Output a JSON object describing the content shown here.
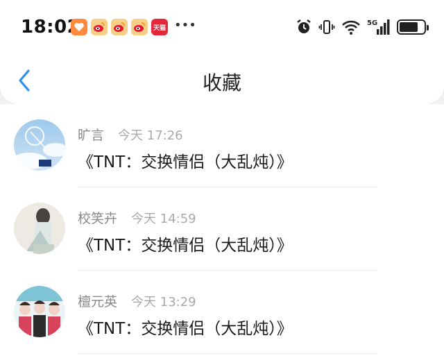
{
  "status_bar": {
    "time": "18:02",
    "app_icons": [
      {
        "name": "orange-app-icon",
        "glyph": "♡",
        "color": "#ff8a3d"
      },
      {
        "name": "weibo-icon",
        "glyph": "◉",
        "color": "#f6d089"
      },
      {
        "name": "weibo-icon",
        "glyph": "◉",
        "color": "#f6d089"
      },
      {
        "name": "weibo-icon",
        "glyph": "◉",
        "color": "#f6d089"
      },
      {
        "name": "tmall-icon",
        "glyph": "天猫",
        "color": "#e4283a"
      }
    ],
    "more": "•••",
    "network_label": "5G",
    "battery_level": 0.75
  },
  "navbar": {
    "back_icon": "chevron-left-icon",
    "title": "收藏",
    "accent": "#2f8ff0"
  },
  "favorites": [
    {
      "name": "旷言",
      "time": "今天 17:26",
      "content": "《TNT：交换情侣（大乱炖）》",
      "avatar": "sky-bottle"
    },
    {
      "name": "校笑卉",
      "time": "今天 14:59",
      "content": "《TNT：交换情侣（大乱炖）》",
      "avatar": "girl-figure"
    },
    {
      "name": "檀元英",
      "time": "今天 13:29",
      "content": "《TNT：交换情侣（大乱炖）》",
      "avatar": "group-photo"
    }
  ]
}
